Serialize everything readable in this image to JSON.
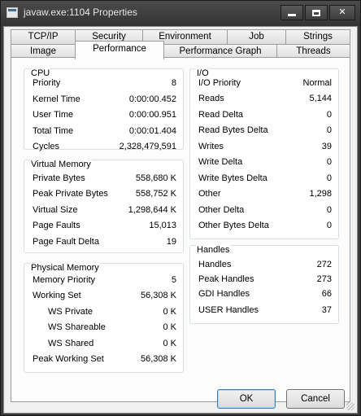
{
  "window": {
    "title": "javaw.exe:1104 Properties"
  },
  "tabs_back": [
    "TCP/IP",
    "Security",
    "Environment",
    "Job",
    "Strings"
  ],
  "tabs_front": [
    "Image",
    "Performance",
    "Performance Graph",
    "Threads"
  ],
  "cpu": {
    "title": "CPU",
    "rows": [
      {
        "label": "Priority",
        "value": "8"
      },
      {
        "label": "Kernel Time",
        "value": "0:00:00.452"
      },
      {
        "label": "User Time",
        "value": "0:00:00.951"
      },
      {
        "label": "Total Time",
        "value": "0:00:01.404"
      },
      {
        "label": "Cycles",
        "value": "2,328,479,591"
      }
    ]
  },
  "virtual_memory": {
    "title": "Virtual Memory",
    "rows": [
      {
        "label": "Private Bytes",
        "value": "558,680 K"
      },
      {
        "label": "Peak Private Bytes",
        "value": "558,752 K"
      },
      {
        "label": "Virtual Size",
        "value": "1,298,644 K"
      },
      {
        "label": "Page Faults",
        "value": "15,013"
      },
      {
        "label": "Page Fault Delta",
        "value": "19"
      }
    ]
  },
  "physical_memory": {
    "title": "Physical Memory",
    "rows": [
      {
        "label": "Memory Priority",
        "value": "5"
      },
      {
        "label": "Working Set",
        "value": "56,308 K"
      },
      {
        "label": "WS Private",
        "value": "0 K"
      },
      {
        "label": "WS Shareable",
        "value": "0 K"
      },
      {
        "label": "WS Shared",
        "value": "0 K"
      },
      {
        "label": "Peak Working Set",
        "value": "56,308 K"
      }
    ]
  },
  "io": {
    "title": "I/O",
    "rows": [
      {
        "label": "I/O Priority",
        "value": "Normal"
      },
      {
        "label": "Reads",
        "value": "5,144"
      },
      {
        "label": "Read Delta",
        "value": "0"
      },
      {
        "label": "Read Bytes Delta",
        "value": "0"
      },
      {
        "label": "Writes",
        "value": "39"
      },
      {
        "label": "Write Delta",
        "value": "0"
      },
      {
        "label": "Write Bytes Delta",
        "value": "0"
      },
      {
        "label": "Other",
        "value": "1,298"
      },
      {
        "label": "Other Delta",
        "value": "0"
      },
      {
        "label": "Other Bytes Delta",
        "value": "0"
      }
    ]
  },
  "handles": {
    "title": "Handles",
    "rows": [
      {
        "label": "Handles",
        "value": "272"
      },
      {
        "label": "Peak Handles",
        "value": "273"
      },
      {
        "label": "GDI Handles",
        "value": "66"
      },
      {
        "label": "USER Handles",
        "value": "37"
      }
    ]
  },
  "buttons": {
    "ok": "OK",
    "cancel": "Cancel"
  },
  "colors": {
    "title_bar": "#3c3c3c",
    "group_border": "#d5dfe5",
    "dialog_bg": "#f0f0f0"
  }
}
